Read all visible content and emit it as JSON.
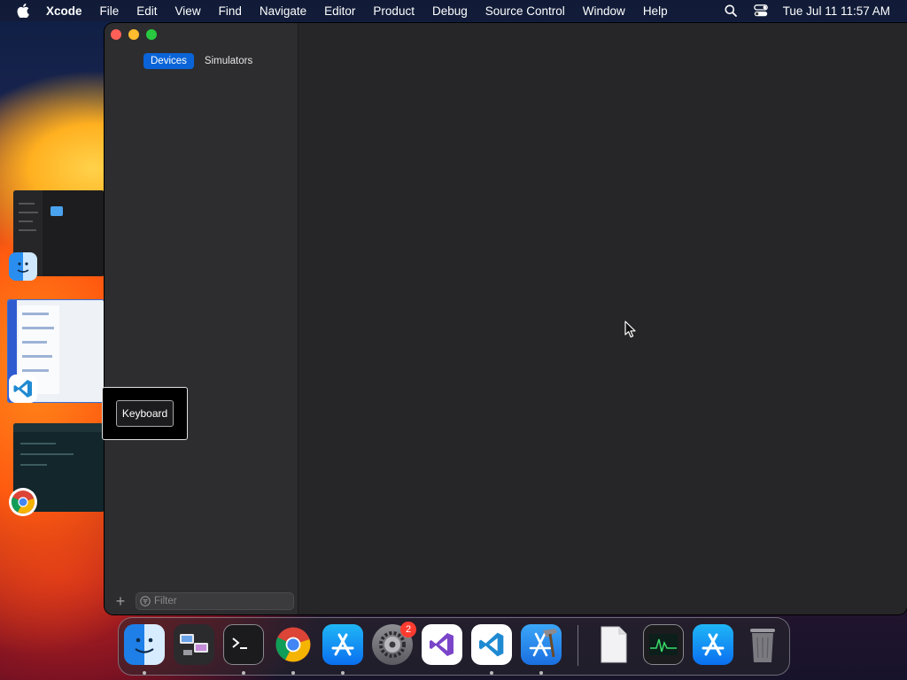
{
  "menubar": {
    "app_name": "Xcode",
    "items": [
      "File",
      "Edit",
      "View",
      "Find",
      "Navigate",
      "Editor",
      "Product",
      "Debug",
      "Source Control",
      "Window",
      "Help"
    ],
    "clock": "Tue Jul 11  11:57 AM"
  },
  "window": {
    "segments": {
      "devices": "Devices",
      "simulators": "Simulators",
      "selected": "Devices"
    },
    "filter": {
      "placeholder": "Filter",
      "value": ""
    }
  },
  "tooltip": {
    "label": "Keyboard"
  },
  "dock": {
    "apps": [
      {
        "name": "finder-icon",
        "running": true
      },
      {
        "name": "migration-assistant-icon",
        "running": false
      },
      {
        "name": "terminal-icon",
        "running": true
      },
      {
        "name": "chrome-icon",
        "running": true
      },
      {
        "name": "app-store-icon",
        "running": true
      },
      {
        "name": "system-settings-icon",
        "running": false,
        "badge": "2"
      },
      {
        "name": "visual-studio-icon",
        "running": false
      },
      {
        "name": "vscode-icon",
        "running": true
      },
      {
        "name": "xcode-icon",
        "running": true
      },
      {
        "name": "document-icon",
        "running": false
      },
      {
        "name": "activity-monitor-icon",
        "running": false
      },
      {
        "name": "app-store-icon",
        "running": false
      },
      {
        "name": "trash-icon",
        "running": false
      }
    ],
    "settings_badge": "2"
  },
  "colors": {
    "accent": "#0a64d8",
    "window_bg": "#262628",
    "sidebar_bg": "#2d2d2f",
    "badge_red": "#ff3b30"
  }
}
